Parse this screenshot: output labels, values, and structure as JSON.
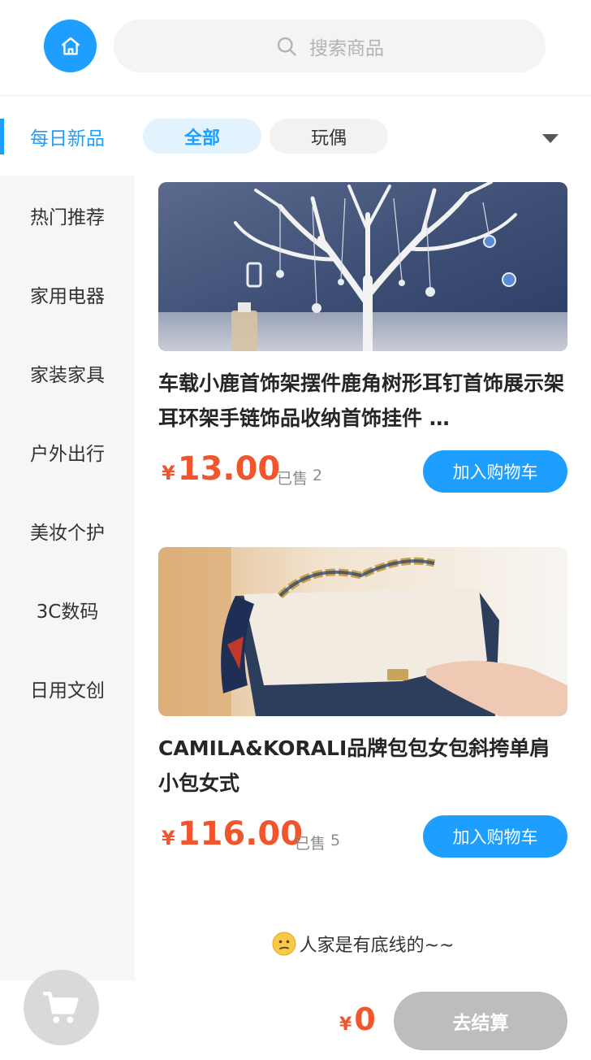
{
  "header": {
    "home_icon": "home-icon",
    "search": {
      "icon": "search-icon",
      "placeholder": "搜索商品"
    }
  },
  "sidebar": {
    "items": [
      {
        "label": "每日新品",
        "active": true
      },
      {
        "label": "热门推荐",
        "active": false
      },
      {
        "label": "家用电器",
        "active": false
      },
      {
        "label": "家装家具",
        "active": false
      },
      {
        "label": "户外出行",
        "active": false
      },
      {
        "label": "美妆个护",
        "active": false
      },
      {
        "label": "3C数码",
        "active": false
      },
      {
        "label": "日用文创",
        "active": false
      }
    ]
  },
  "filters": {
    "chips": [
      {
        "label": "全部",
        "active": true
      },
      {
        "label": "玩偶",
        "active": false
      }
    ],
    "expand_icon": "caret-down-icon"
  },
  "products": [
    {
      "image": "jewelry-tree-stand-photo",
      "title": "车载小鹿首饰架摆件鹿角树形耳钉首饰展示架耳环架手链饰品收纳首饰挂件 …",
      "currency": "¥",
      "price": "13.00",
      "sold_label": "已售",
      "sold_count": "2",
      "add_label": "加入购物车"
    },
    {
      "image": "handbag-photo",
      "title": "CAMILA&KORALI品牌包包女包斜挎单肩小包女式",
      "currency": "¥",
      "price": "116.00",
      "sold_label": "已售",
      "sold_count": "5",
      "add_label": "加入购物车"
    }
  ],
  "footer_note": "人家是有底线的~~",
  "bottom_bar": {
    "cart_icon": "cart-icon",
    "currency": "¥",
    "total": "0",
    "checkout_label": "去结算"
  },
  "colors": {
    "accent": "#1e9fff",
    "price": "#f0552d",
    "disabled": "#bdbdbd"
  }
}
